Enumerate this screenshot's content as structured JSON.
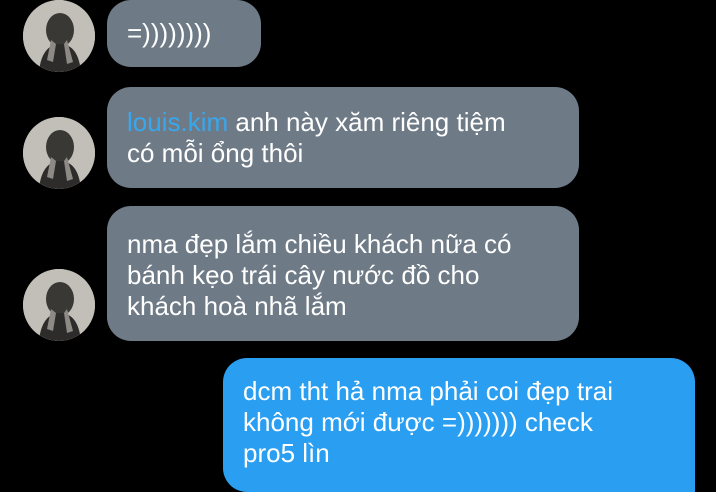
{
  "colors": {
    "background": "#000000",
    "incoming_bubble": "#6e7b87",
    "outgoing_bubble": "#2a9ff2",
    "mention": "#37a7ee",
    "text": "#ffffff"
  },
  "messages": [
    {
      "direction": "incoming",
      "avatar": "user-avatar",
      "lines": [
        "=))))))))"
      ]
    },
    {
      "direction": "incoming",
      "avatar": "user-avatar",
      "mention": "louis.kim",
      "lines": [
        " anh này xăm riêng tiệm",
        "có mỗi ổng thôi"
      ]
    },
    {
      "direction": "incoming",
      "avatar": "user-avatar",
      "lines": [
        "nma đẹp lắm chiều khách nữa có",
        "bánh kẹo trái cây nước đồ cho",
        "khách hoà nhã lắm"
      ]
    },
    {
      "direction": "outgoing",
      "lines": [
        "dcm tht hả nma phải coi đẹp trai",
        "không mới được =))))))) check",
        "pro5 lìn"
      ]
    }
  ]
}
